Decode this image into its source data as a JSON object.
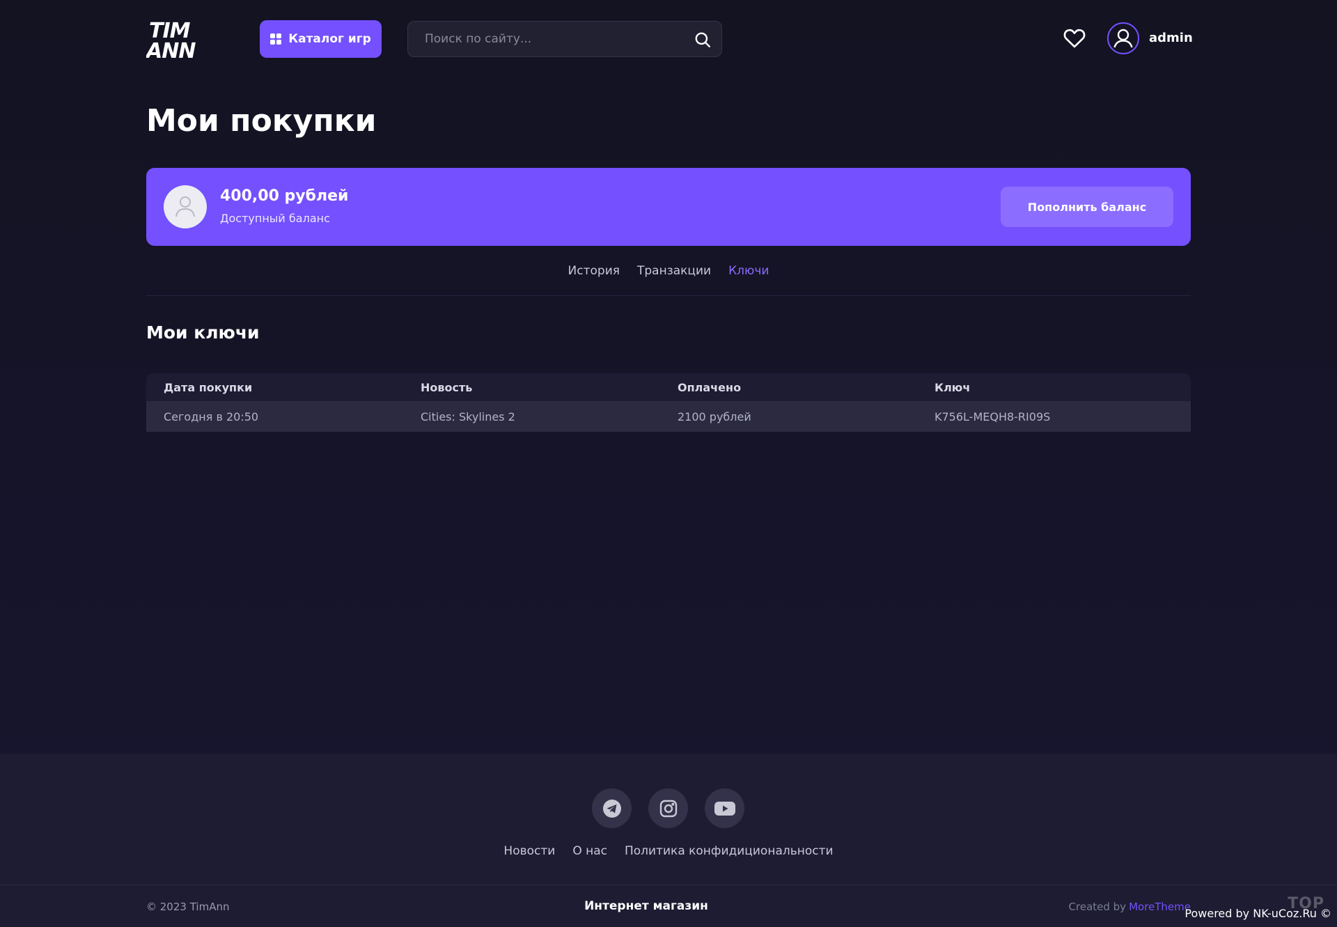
{
  "header": {
    "logo_line1": "TIM",
    "logo_line2": "ANN",
    "catalog_label": "Каталог игр",
    "search_placeholder": "Поиск по сайту...",
    "username": "admin",
    "icons": {
      "catalog": "grid-icon",
      "search": "search-icon",
      "favorites": "heart-icon",
      "user": "user-icon"
    }
  },
  "page_title": "Мои покупки",
  "balance": {
    "amount": "400,00 рублей",
    "label": "Доступный баланс",
    "topup_label": "Пополнить баланс"
  },
  "tabs": [
    {
      "label": "История",
      "active": false
    },
    {
      "label": "Транзакции",
      "active": false
    },
    {
      "label": "Ключи",
      "active": true
    }
  ],
  "section_title": "Мои ключи",
  "table": {
    "columns": [
      "Дата покупки",
      "Новость",
      "Оплачено",
      "Ключ"
    ],
    "rows": [
      [
        "Сегодня в 20:50",
        "Cities: Skylines 2",
        "2100 рублей",
        "K756L-MEQH8-RI09S"
      ]
    ]
  },
  "footer": {
    "socials": [
      "telegram-icon",
      "instagram-icon",
      "youtube-icon"
    ],
    "links": [
      "Новости",
      "О нас",
      "Политика конфидициональности"
    ],
    "copyright": "© 2023 TimAnn",
    "shop_label": "Интернет магазин",
    "created_by_label": "Created by",
    "created_by_brand": "MoreTheme",
    "top_badge": "TOP",
    "powered_by": "Powered by NK-uCoz.Ru ©"
  },
  "colors": {
    "accent": "#7450fe",
    "background": "#15142a",
    "footer": "#1d1c32"
  }
}
